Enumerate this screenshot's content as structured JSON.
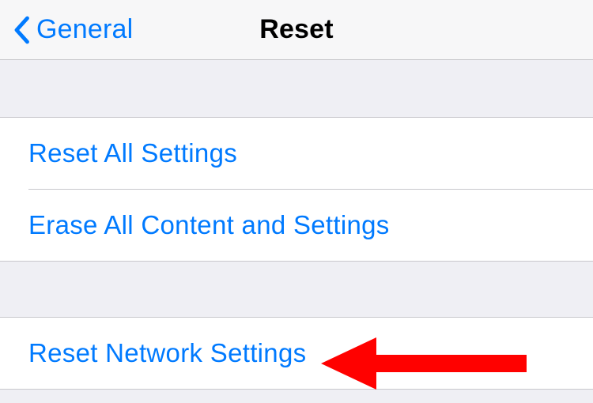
{
  "nav": {
    "back_label": "General",
    "title": "Reset"
  },
  "groups": [
    {
      "items": [
        {
          "label": "Reset All Settings"
        },
        {
          "label": "Erase All Content and Settings"
        }
      ]
    },
    {
      "items": [
        {
          "label": "Reset Network Settings"
        }
      ]
    }
  ],
  "annotation": {
    "color": "#ff0100"
  }
}
